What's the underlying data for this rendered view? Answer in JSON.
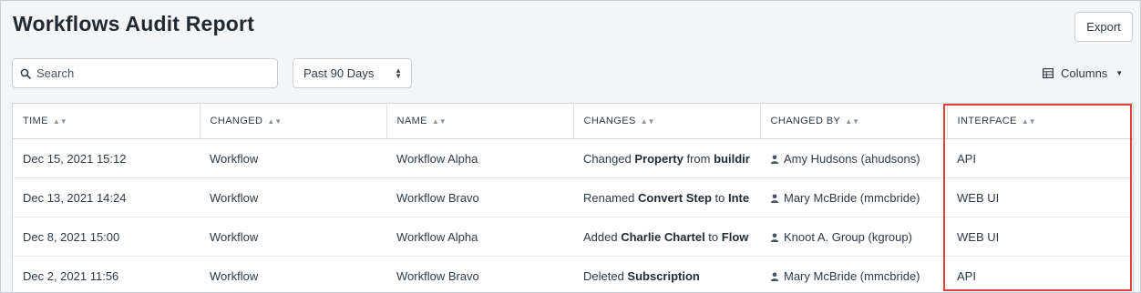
{
  "page": {
    "title": "Workflows Audit Report",
    "export_label": "Export",
    "search_placeholder": "Search",
    "date_range": "Past 90 Days",
    "columns_label": "Columns"
  },
  "table": {
    "headers": [
      "TIME",
      "CHANGED",
      "NAME",
      "CHANGES",
      "CHANGED BY",
      "INTERFACE"
    ],
    "rows": [
      {
        "time": "Dec 15, 2021 15:12",
        "changed": "Workflow",
        "name": "Workflow Alpha",
        "changes": {
          "pre": "Changed ",
          "b1": "Property",
          "mid": " from ",
          "b2": "buildir"
        },
        "changed_by": "Amy Hudsons (ahudsons)",
        "interface": "API"
      },
      {
        "time": "Dec 13, 2021 14:24",
        "changed": "Workflow",
        "name": "Workflow Bravo",
        "changes": {
          "pre": "Renamed ",
          "b1": "Convert Step",
          "mid": " to ",
          "b2": "Inte"
        },
        "changed_by": "Mary McBride (mmcbride)",
        "interface": "WEB UI"
      },
      {
        "time": "Dec 8, 2021 15:00",
        "changed": "Workflow",
        "name": "Workflow Alpha",
        "changes": {
          "pre": "Added ",
          "b1": "Charlie Chartel",
          "mid": " to ",
          "b2": "Flow"
        },
        "changed_by": "Knoot A. Group (kgroup)",
        "interface": "WEB UI"
      },
      {
        "time": "Dec 2, 2021 11:56",
        "changed": "Workflow",
        "name": "Workflow Bravo",
        "changes": {
          "pre": "Deleted ",
          "b1": "Subscription",
          "mid": "",
          "b2": ""
        },
        "changed_by": "Mary McBride (mmcbride)",
        "interface": "API"
      }
    ]
  },
  "colors": {
    "highlight": "#e0403a",
    "background": "#f4f5f7"
  }
}
